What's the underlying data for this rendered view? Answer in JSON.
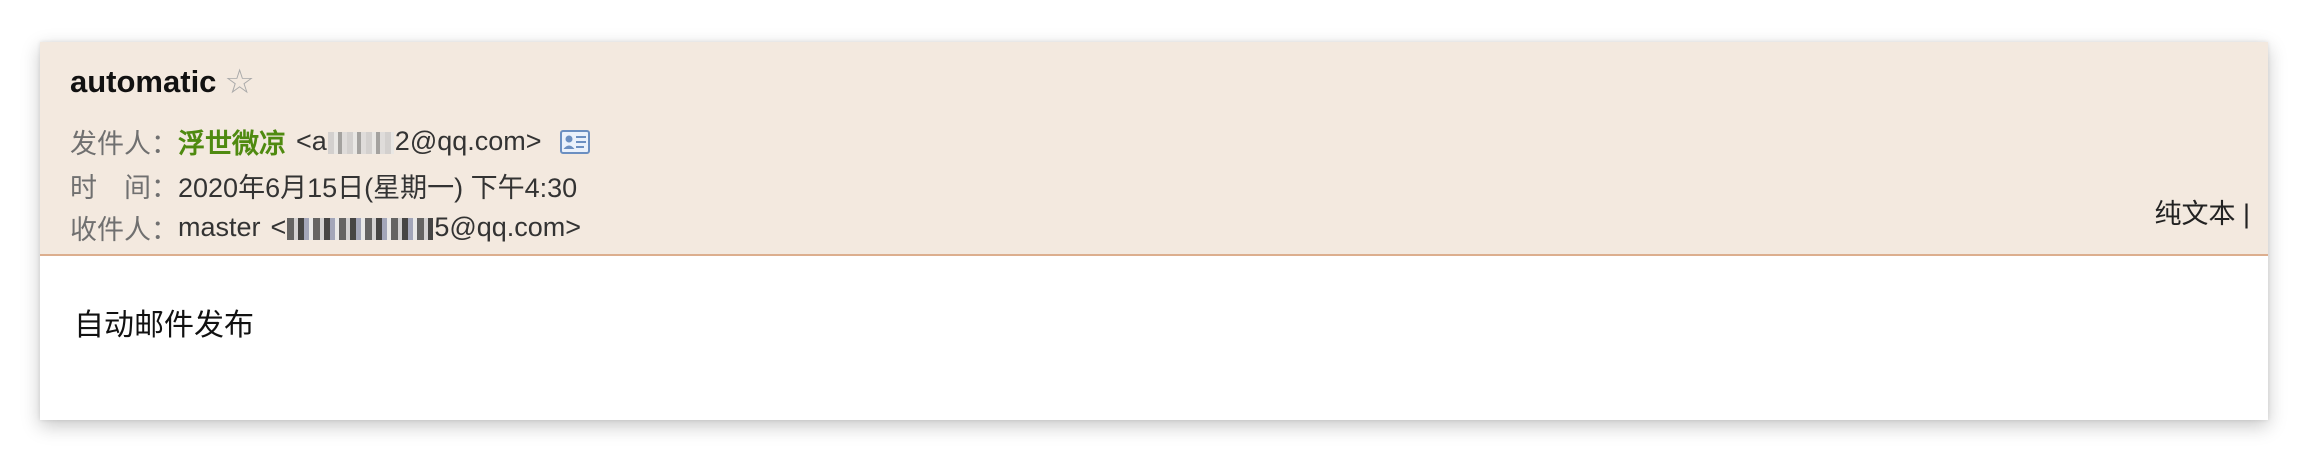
{
  "mail": {
    "subject": "automatic",
    "star_glyph": "☆",
    "sender": {
      "label": "发件人：",
      "name": "浮世微凉",
      "email_prefix": "<a",
      "email_suffix": "2@qq.com>"
    },
    "time": {
      "label": "时　间：",
      "value": "2020年6月15日(星期一) 下午4:30"
    },
    "recipient": {
      "label": "收件人：",
      "name": "master",
      "email_prefix": "<",
      "email_suffix": "5@qq.com>"
    },
    "plain_text_link": "纯文本 |",
    "body": "自动邮件发布"
  },
  "colors": {
    "header_bg": "#f3e9df",
    "header_border": "#dcae8e",
    "sender_name": "#4f8a10",
    "label": "#707070",
    "icon_blue": "#6b8fc1"
  },
  "icons": {
    "star": "star-icon",
    "contact_card": "contact-card-icon"
  }
}
